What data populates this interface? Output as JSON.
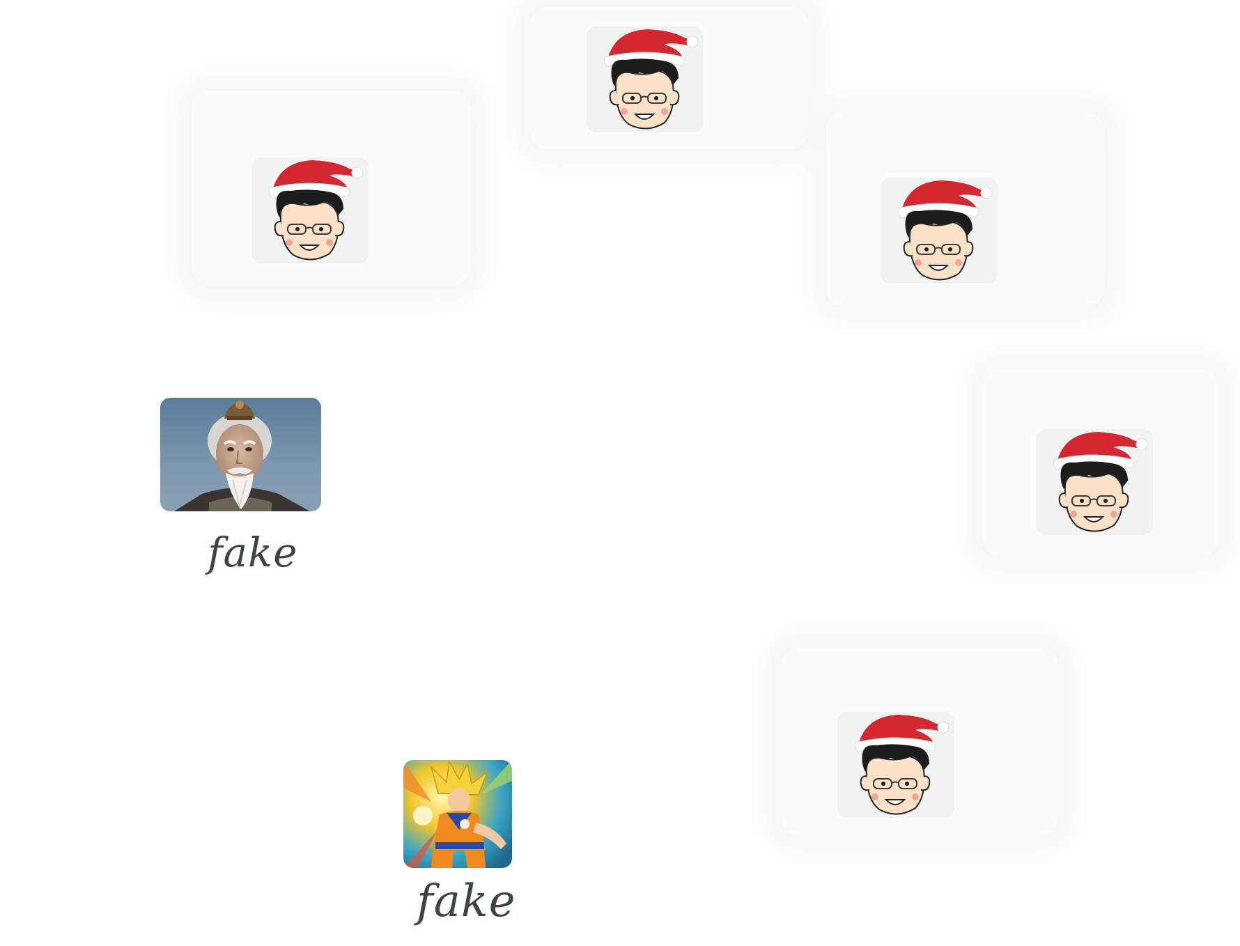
{
  "avatars": [
    {
      "icon": "santa-hat-cartoon-avatar"
    },
    {
      "icon": "santa-hat-cartoon-avatar"
    },
    {
      "icon": "santa-hat-cartoon-avatar"
    },
    {
      "icon": "santa-hat-cartoon-avatar"
    },
    {
      "icon": "santa-hat-cartoon-avatar"
    }
  ],
  "photos": [
    {
      "icon": "old-man-photo",
      "caption": "fake"
    },
    {
      "icon": "anime-warrior-photo",
      "caption": "fake"
    }
  ],
  "colors": {
    "tile_background": "#f1f2f2",
    "hat_red": "#d3282f",
    "caption_ink": "#3c4542"
  }
}
